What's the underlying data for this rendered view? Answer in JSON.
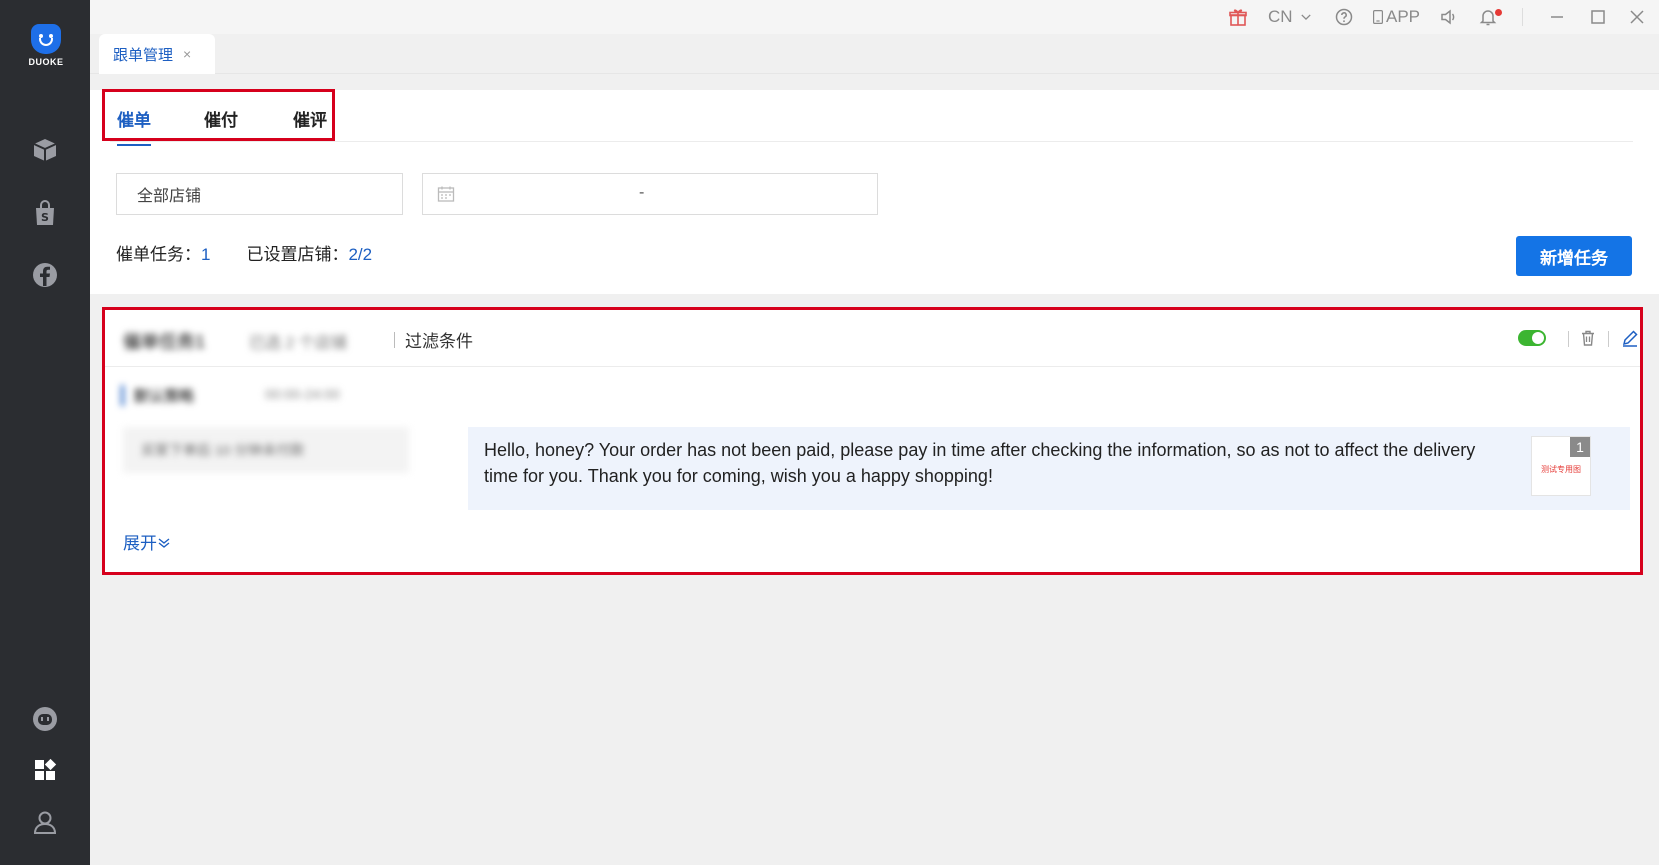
{
  "sidebar": {
    "logo_text": "DUOKE",
    "icons": [
      "box-icon",
      "shop-bag-icon",
      "facebook-icon",
      "robot-icon",
      "apps-icon",
      "user-icon"
    ]
  },
  "topbar": {
    "language": "CN",
    "app_label": "APP"
  },
  "page_tab": {
    "label": "跟单管理",
    "close": "×"
  },
  "sub_tabs": [
    {
      "label": "催单",
      "active": true
    },
    {
      "label": "催付",
      "active": false
    },
    {
      "label": "催评",
      "active": false
    }
  ],
  "filters": {
    "store": "全部店铺",
    "date_sep": "-"
  },
  "stats": {
    "task_label": "催单任务：",
    "task_count": "1",
    "store_label": "已设置店铺：",
    "store_count": "2/2"
  },
  "new_task_button": "新增任务",
  "task_card": {
    "name": "催单任务1",
    "meta": "已选 2 个店铺",
    "filter_label": "过滤条件",
    "sub_label": "默认策略",
    "sub_time": "00:00-24:00",
    "condition": "买家下单后 10 分钟未付款",
    "message": "Hello, honey? Your order has not been paid, please pay in time after checking the information, so as not to affect the delivery time for you. Thank you for coming, wish you a happy shopping!",
    "thumb_badge": "1",
    "thumb_text": "测试专用图",
    "enabled": true,
    "expand_label": "展开"
  },
  "colors": {
    "accent": "#1d5fc2",
    "button": "#1474e6",
    "highlight_outline": "#d6001c",
    "toggle_on": "#3cb531",
    "sidebar_bg": "#2b2d31"
  }
}
